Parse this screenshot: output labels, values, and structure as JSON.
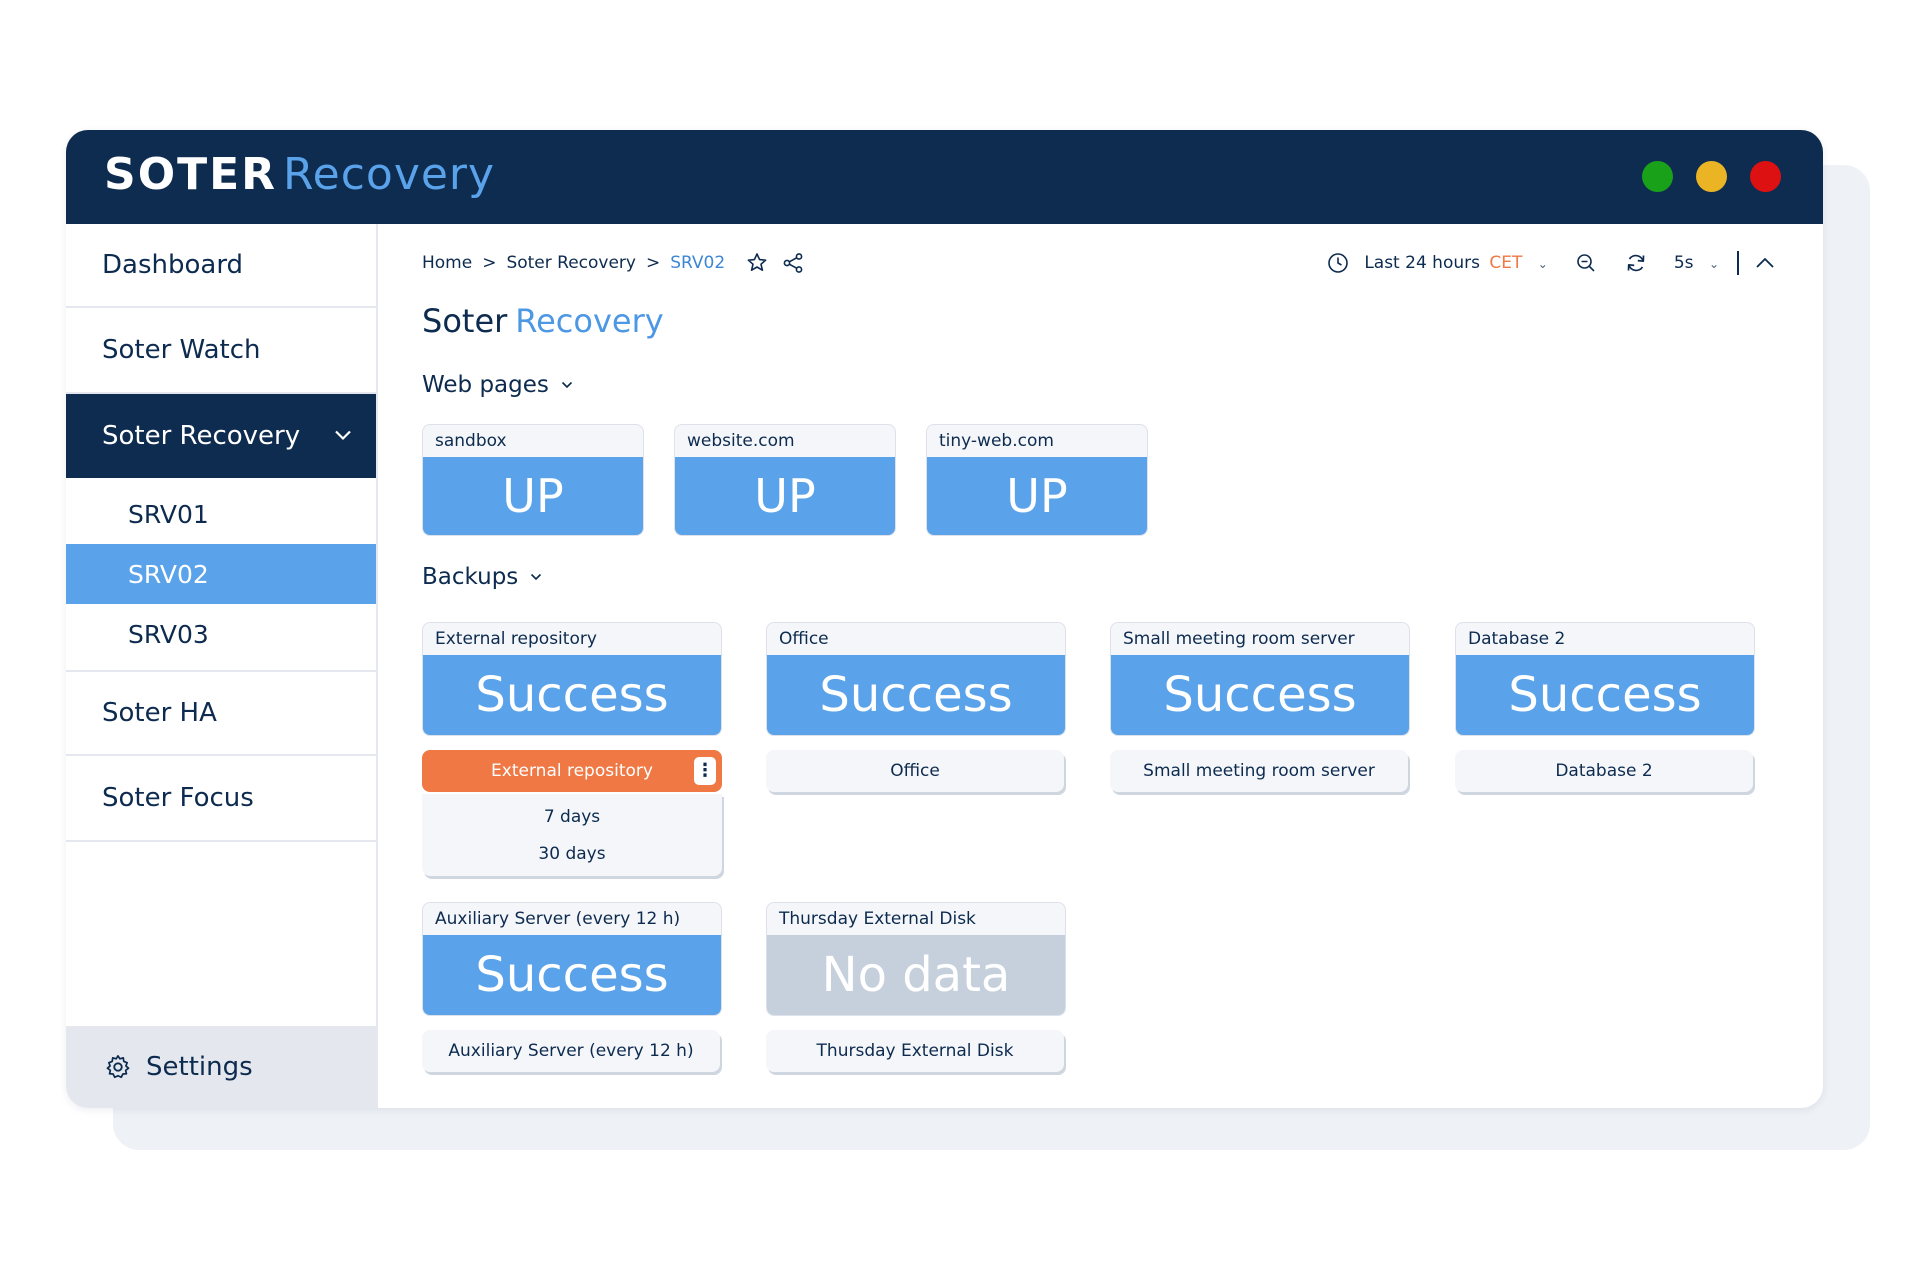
{
  "app": {
    "brand_strong": "SOTER",
    "brand_light": "Recovery",
    "colors": {
      "navy": "#0e2b50",
      "accent": "#5aa2ea",
      "orange": "#ef7844",
      "nodata": "#c6d0dc"
    }
  },
  "window_controls": [
    "green-dot",
    "yellow-dot",
    "red-dot"
  ],
  "sidebar": {
    "items": [
      {
        "label": "Dashboard"
      },
      {
        "label": "Soter Watch"
      },
      {
        "label": "Soter Recovery",
        "expanded": true
      },
      {
        "label": "Soter HA"
      },
      {
        "label": "Soter Focus"
      }
    ],
    "sub_items": [
      {
        "label": "SRV01"
      },
      {
        "label": "SRV02",
        "active": true
      },
      {
        "label": "SRV03"
      }
    ],
    "settings_label": "Settings"
  },
  "breadcrumb": {
    "items": [
      "Home",
      "Soter Recovery",
      "SRV02"
    ],
    "separator": ">"
  },
  "toolbar": {
    "time_range": "Last 24 hours",
    "timezone": "CET",
    "refresh_interval": "5s"
  },
  "page": {
    "title_1": "Soter",
    "title_2": "Recovery"
  },
  "web_pages": {
    "title": "Web pages",
    "panels": [
      {
        "title": "sandbox",
        "status": "UP"
      },
      {
        "title": "website.com",
        "status": "UP"
      },
      {
        "title": "tiny-web.com",
        "status": "UP"
      }
    ]
  },
  "backups": {
    "title": "Backups",
    "panels": [
      {
        "title": "External repository",
        "status": "Success",
        "button": "External repository",
        "open": true,
        "options": [
          "7 days",
          "30 days"
        ]
      },
      {
        "title": "Office",
        "status": "Success",
        "button": "Office"
      },
      {
        "title": "Small meeting room server",
        "status": "Success",
        "button": "Small meeting room server"
      },
      {
        "title": "Database 2",
        "status": "Success",
        "button": "Database 2"
      },
      {
        "title": "Auxiliary Server (every 12 h)",
        "status": "Success",
        "button": "Auxiliary Server (every 12 h)"
      },
      {
        "title": "Thursday External Disk",
        "status": "No data",
        "button": "Thursday External Disk"
      }
    ]
  }
}
